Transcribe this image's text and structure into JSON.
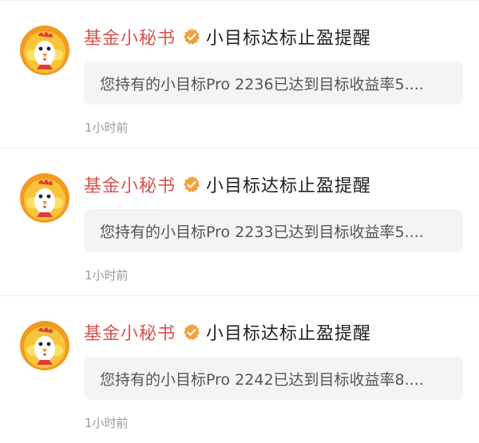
{
  "notifications": [
    {
      "sender": "基金小秘书",
      "title": "小目标达标止盈提醒",
      "message": "您持有的小目标Pro 2236已达到目标收益率5....",
      "time": "1小时前"
    },
    {
      "sender": "基金小秘书",
      "title": "小目标达标止盈提醒",
      "message": "您持有的小目标Pro 2233已达到目标收益率5....",
      "time": "1小时前"
    },
    {
      "sender": "基金小秘书",
      "title": "小目标达标止盈提醒",
      "message": "您持有的小目标Pro 2242已达到目标收益率8....",
      "time": "1小时前"
    }
  ],
  "icons": {
    "avatar": "chicken-mascot-icon",
    "verified": "verified-badge-icon"
  },
  "colors": {
    "sender": "#d9534f",
    "badge": "#f2a23a",
    "bubble": "#f4f4f4",
    "time": "#9a9a9a"
  }
}
